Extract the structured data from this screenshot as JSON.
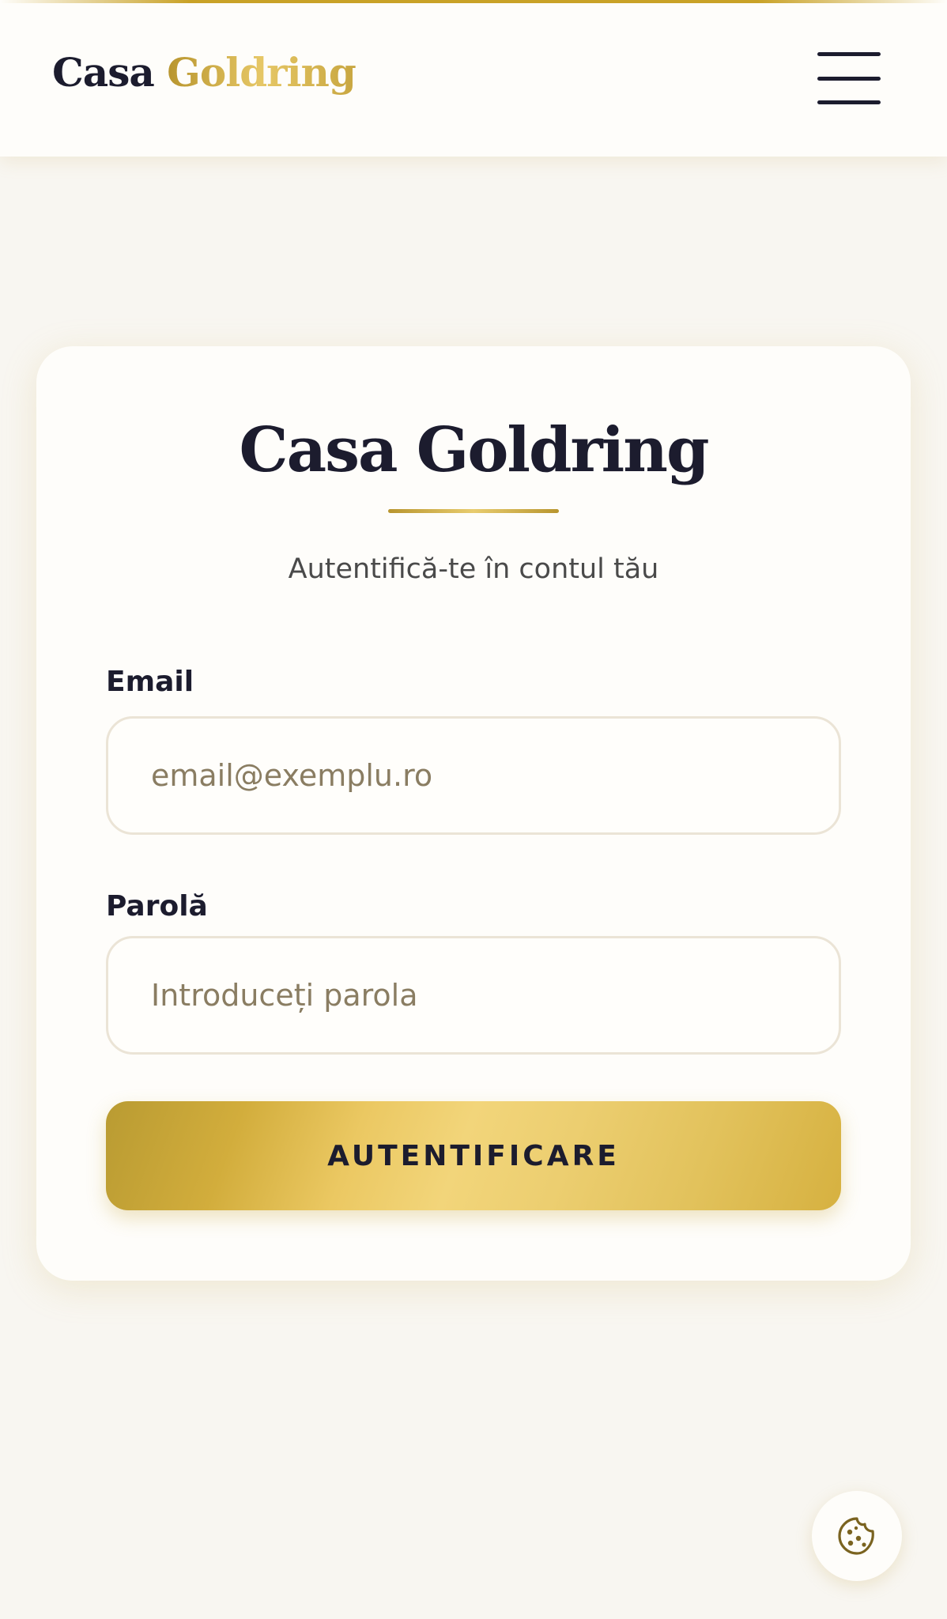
{
  "header": {
    "brand_part1": "Casa",
    "brand_part2": "Goldring",
    "menu_icon": "hamburger-menu-icon"
  },
  "login": {
    "title": "Casa Goldring",
    "subtitle": "Autentifică-te în contul tău",
    "email_label": "Email",
    "email_placeholder": "email@exemplu.ro",
    "email_value": "",
    "password_label": "Parolă",
    "password_placeholder": "Introduceți parola",
    "password_value": "",
    "submit_label": "AUTENTIFICARE"
  },
  "cookie_button": {
    "icon": "cookie-icon"
  },
  "colors": {
    "navy": "#1c1c2e",
    "gold": "#d4af37",
    "gold_light": "#f2d57a",
    "background": "#f8f6f1",
    "card": "#fefdfa"
  }
}
